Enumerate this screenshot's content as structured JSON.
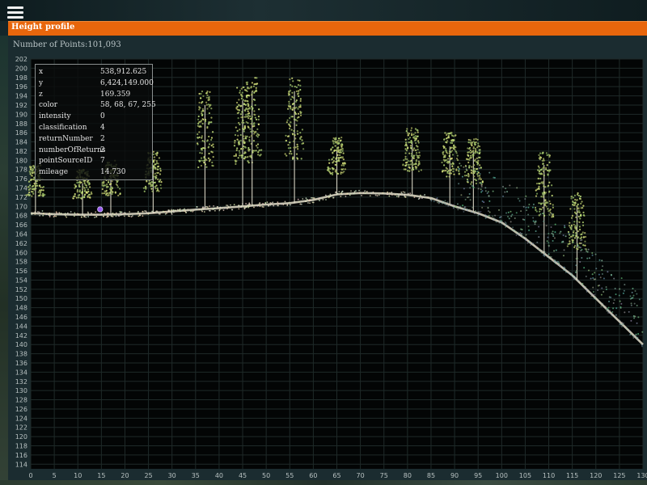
{
  "header": {
    "menu_icon": "hamburger-menu-icon"
  },
  "panel": {
    "title": "Height profile",
    "points_label": "Number of Points:",
    "points_value": "101,093",
    "accent_color": "#e8660c"
  },
  "chart_data": {
    "type": "scatter",
    "title": "",
    "xlabel": "",
    "ylabel": "",
    "xlim": [
      0,
      130
    ],
    "ylim": [
      113,
      202
    ],
    "grid": true,
    "x_ticks": [
      0,
      5,
      10,
      15,
      20,
      25,
      30,
      35,
      40,
      45,
      50,
      55,
      60,
      65,
      70,
      75,
      80,
      85,
      90,
      95,
      100,
      105,
      110,
      115,
      120,
      125,
      130
    ],
    "y_ticks": [
      114,
      116,
      118,
      120,
      122,
      124,
      126,
      128,
      130,
      132,
      134,
      136,
      138,
      140,
      142,
      144,
      146,
      148,
      150,
      152,
      154,
      156,
      158,
      160,
      162,
      164,
      166,
      168,
      170,
      172,
      174,
      176,
      178,
      180,
      182,
      184,
      186,
      188,
      190,
      192,
      194,
      196,
      198,
      200,
      202
    ],
    "ground_profile": [
      [
        0,
        168.5
      ],
      [
        5,
        168.3
      ],
      [
        10,
        168.2
      ],
      [
        15,
        168.2
      ],
      [
        20,
        168.3
      ],
      [
        25,
        168.5
      ],
      [
        30,
        168.9
      ],
      [
        35,
        169.3
      ],
      [
        40,
        169.6
      ],
      [
        45,
        170.0
      ],
      [
        50,
        170.4
      ],
      [
        55,
        170.7
      ],
      [
        60,
        171.4
      ],
      [
        65,
        172.6
      ],
      [
        70,
        172.9
      ],
      [
        75,
        172.8
      ],
      [
        80,
        172.5
      ],
      [
        85,
        171.8
      ],
      [
        90,
        170.0
      ],
      [
        95,
        168.5
      ],
      [
        100,
        166.5
      ],
      [
        105,
        163.0
      ],
      [
        110,
        159.0
      ],
      [
        115,
        155.0
      ],
      [
        120,
        150.0
      ],
      [
        125,
        145.0
      ],
      [
        130,
        140.0
      ]
    ],
    "trees": [
      {
        "x": 1,
        "base": 168.5,
        "top": 179
      },
      {
        "x": 11,
        "base": 168.2,
        "top": 178
      },
      {
        "x": 17,
        "base": 168.2,
        "top": 180
      },
      {
        "x": 26,
        "base": 168.5,
        "top": 182
      },
      {
        "x": 37,
        "base": 169.5,
        "top": 195
      },
      {
        "x": 45,
        "base": 170.0,
        "top": 196
      },
      {
        "x": 47,
        "base": 170.1,
        "top": 198
      },
      {
        "x": 56,
        "base": 170.7,
        "top": 198
      },
      {
        "x": 65,
        "base": 172.5,
        "top": 185
      },
      {
        "x": 81,
        "base": 172.5,
        "top": 187
      },
      {
        "x": 89,
        "base": 170.5,
        "top": 186
      },
      {
        "x": 94,
        "base": 169.0,
        "top": 185
      },
      {
        "x": 109,
        "base": 160.0,
        "top": 182
      },
      {
        "x": 116,
        "base": 154.0,
        "top": 173
      }
    ],
    "selected_point": {
      "x": 14.73,
      "y": 169.359
    }
  },
  "info_box": {
    "rows": [
      {
        "key": "x",
        "value": "538,912.625"
      },
      {
        "key": "y",
        "value": "6,424,149.000"
      },
      {
        "key": "z",
        "value": "169.359"
      },
      {
        "key": "color",
        "value": "58, 68, 67, 255"
      },
      {
        "key": "intensity",
        "value": "0"
      },
      {
        "key": "classification",
        "value": "4"
      },
      {
        "key": "returnNumber",
        "value": "2"
      },
      {
        "key": "numberOfReturns",
        "value": "2"
      },
      {
        "key": "pointSourceID",
        "value": "7"
      },
      {
        "key": "mileage",
        "value": "14.730"
      }
    ]
  }
}
